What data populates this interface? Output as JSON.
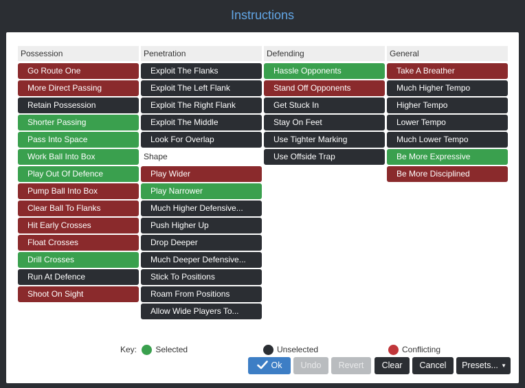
{
  "window": {
    "title": "Instructions"
  },
  "colors": {
    "selected": "#3aa04e",
    "unselected": "#2b2e33",
    "conflicting": "#8a2a2c",
    "ok_button": "#3d7ec5",
    "title": "#62a6e6"
  },
  "columns": {
    "possession": {
      "header": "Possession",
      "items": [
        {
          "label": "Go Route One",
          "state": "conflicting"
        },
        {
          "label": "More Direct Passing",
          "state": "conflicting"
        },
        {
          "label": "Retain Possession",
          "state": "unselected"
        },
        {
          "label": "Shorter Passing",
          "state": "selected"
        },
        {
          "label": "Pass Into Space",
          "state": "selected"
        },
        {
          "label": "Work Ball Into Box",
          "state": "selected"
        },
        {
          "label": "Play Out Of Defence",
          "state": "selected"
        },
        {
          "label": "Pump Ball Into Box",
          "state": "conflicting"
        },
        {
          "label": "Clear Ball To Flanks",
          "state": "conflicting"
        },
        {
          "label": "Hit Early Crosses",
          "state": "conflicting"
        },
        {
          "label": "Float Crosses",
          "state": "conflicting"
        },
        {
          "label": "Drill Crosses",
          "state": "selected"
        },
        {
          "label": "Run At Defence",
          "state": "unselected"
        },
        {
          "label": "Shoot On Sight",
          "state": "conflicting"
        }
      ]
    },
    "penetration": {
      "header": "Penetration",
      "items": [
        {
          "label": "Exploit The Flanks",
          "state": "unselected"
        },
        {
          "label": "Exploit The Left Flank",
          "state": "unselected"
        },
        {
          "label": "Exploit The Right Flank",
          "state": "unselected"
        },
        {
          "label": "Exploit The Middle",
          "state": "unselected"
        },
        {
          "label": "Look For Overlap",
          "state": "unselected"
        }
      ]
    },
    "shape": {
      "header": "Shape",
      "items": [
        {
          "label": "Play Wider",
          "state": "conflicting"
        },
        {
          "label": "Play Narrower",
          "state": "selected"
        },
        {
          "label": "Much Higher Defensive...",
          "state": "unselected"
        },
        {
          "label": "Push Higher Up",
          "state": "unselected"
        },
        {
          "label": "Drop Deeper",
          "state": "unselected"
        },
        {
          "label": "Much Deeper Defensive...",
          "state": "unselected"
        },
        {
          "label": "Stick To Positions",
          "state": "unselected"
        },
        {
          "label": "Roam From Positions",
          "state": "unselected"
        },
        {
          "label": "Allow Wide Players To...",
          "state": "unselected"
        }
      ]
    },
    "defending": {
      "header": "Defending",
      "items": [
        {
          "label": "Hassle Opponents",
          "state": "selected"
        },
        {
          "label": "Stand Off Opponents",
          "state": "conflicting"
        },
        {
          "label": "Get Stuck In",
          "state": "unselected"
        },
        {
          "label": "Stay On Feet",
          "state": "unselected"
        },
        {
          "label": "Use Tighter Marking",
          "state": "unselected"
        },
        {
          "label": "Use Offside Trap",
          "state": "unselected"
        }
      ]
    },
    "general": {
      "header": "General",
      "items": [
        {
          "label": "Take A Breather",
          "state": "conflicting"
        },
        {
          "label": "Much Higher Tempo",
          "state": "unselected"
        },
        {
          "label": "Higher Tempo",
          "state": "unselected"
        },
        {
          "label": "Lower Tempo",
          "state": "unselected"
        },
        {
          "label": "Much Lower Tempo",
          "state": "unselected"
        },
        {
          "label": "Be More Expressive",
          "state": "selected"
        },
        {
          "label": "Be More Disciplined",
          "state": "conflicting"
        }
      ]
    }
  },
  "legend": {
    "prefix": "Key:",
    "selected": "Selected",
    "unselected": "Unselected",
    "conflicting": "Conflicting"
  },
  "buttons": {
    "ok": "Ok",
    "undo": "Undo",
    "revert": "Revert",
    "clear": "Clear",
    "cancel": "Cancel",
    "presets": "Presets..."
  }
}
